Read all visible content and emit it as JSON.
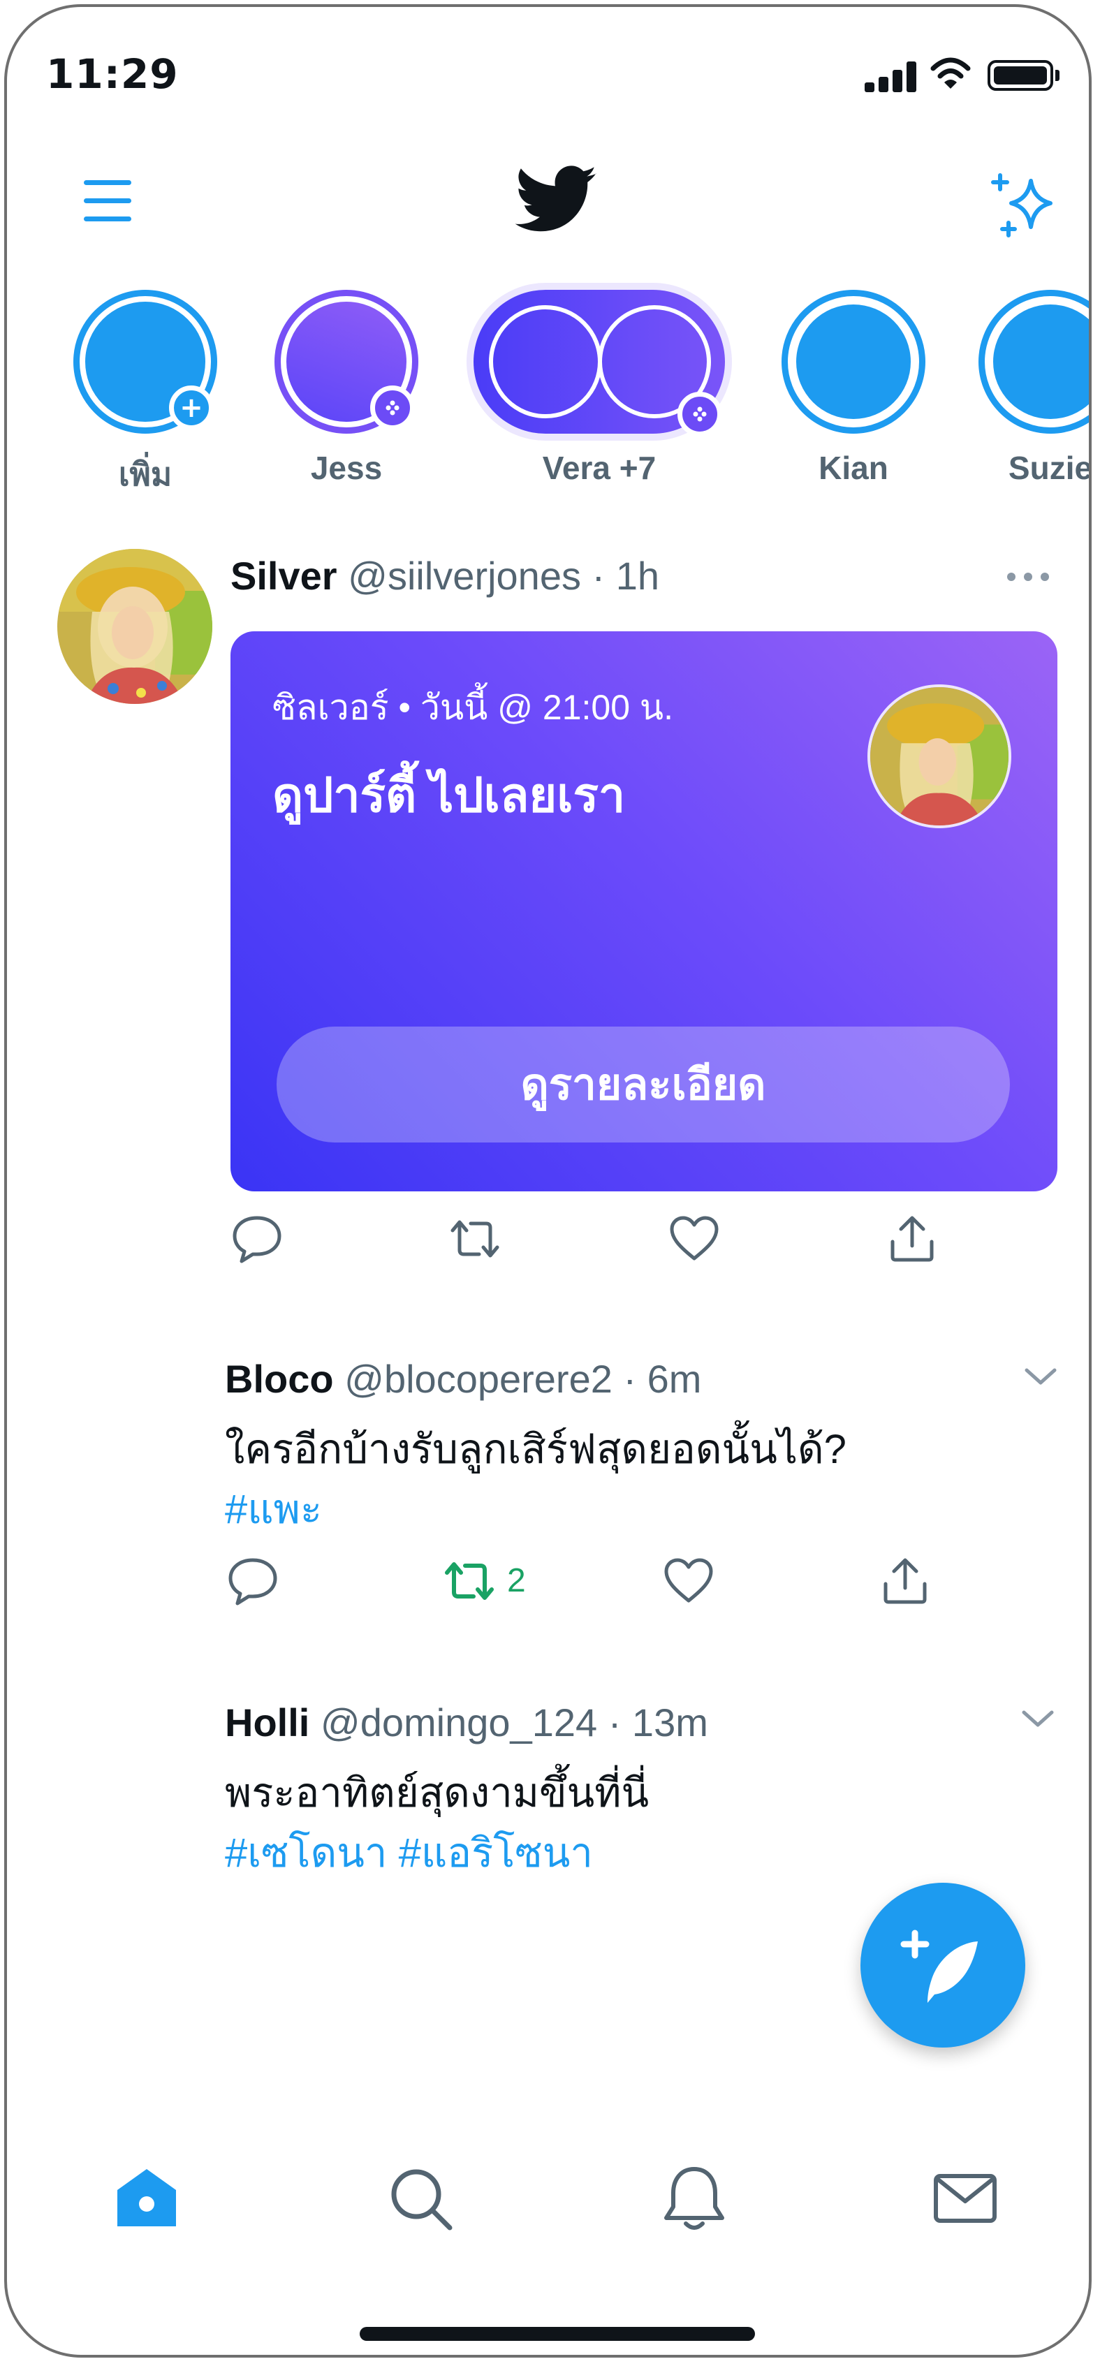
{
  "status_bar": {
    "time": "11:29"
  },
  "stories": [
    {
      "label": "เพิ่ม",
      "badge": "add"
    },
    {
      "label": "Jess",
      "badge": "space"
    },
    {
      "label": "Vera +7",
      "badge": "space"
    },
    {
      "label": "Kian",
      "badge": ""
    },
    {
      "label": "Suzie",
      "badge": ""
    }
  ],
  "tweets": [
    {
      "name": "Silver",
      "handle": "@siilverjones",
      "sep": "·",
      "time": "1h",
      "card": {
        "meta": "ซิลเวอร์ • วันนี้ @ 21:00 น.",
        "title": "ดูปาร์ตี้ ไปเลยเรา",
        "button": "ดูรายละเอียด"
      }
    },
    {
      "name": "Bloco",
      "handle": "@blocoperere2",
      "sep": "·",
      "time": "6m",
      "text": "ใครอีกบ้างรับลูกเสิร์ฟสุดยอดนั้นได้?",
      "hashtags": "#แพะ",
      "retweet_count": "2"
    },
    {
      "name": "Holli",
      "handle": "@domingo_124",
      "sep": "·",
      "time": "13m",
      "text": "พระอาทิตย์สุดงามขึ้นที่นี่",
      "hashtags": "#เซโดนา #แอริโซนา"
    }
  ],
  "colors": {
    "accent": "#1d9bf0",
    "retweet_active": "#1aa264",
    "card_gradient_start": "#3a34f5",
    "card_gradient_end": "#9b64f6"
  },
  "icons": [
    "menu-icon",
    "twitter-bird-icon",
    "sparkle-icon",
    "reply-icon",
    "retweet-icon",
    "like-icon",
    "share-icon",
    "compose-icon",
    "home-icon",
    "search-icon",
    "notifications-icon",
    "messages-icon"
  ]
}
